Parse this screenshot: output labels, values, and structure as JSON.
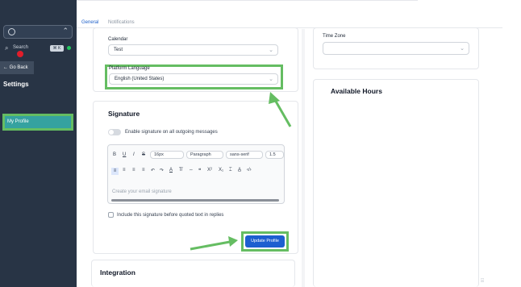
{
  "sidebar": {
    "search_placeholder": "Search",
    "search_shortcut": "⌘ K",
    "go_back_label": "← Go Back",
    "settings_title": "Settings",
    "items": [
      {
        "label": "My Profile",
        "active": true
      }
    ]
  },
  "tabs": [
    {
      "label": "General",
      "active": true
    },
    {
      "label": "Notifications",
      "active": false
    }
  ],
  "profile": {
    "calendar_label": "Calendar",
    "calendar_value": "Test",
    "platform_language_label": "Platform Language",
    "platform_language_value": "English (United States)",
    "time_zone_label": "Time Zone",
    "time_zone_value": ""
  },
  "signature": {
    "title": "Signature",
    "enable_label": "Enable signature on all outgoing messages",
    "enabled": false,
    "toolbar": {
      "bold": "B",
      "underline": "U",
      "italic": "I",
      "strike": "S",
      "font_size": "16px",
      "block_type": "Paragraph",
      "font_family": "sans-serif",
      "line_height": "1.5",
      "undo": "↶",
      "redo": "↷",
      "text_color": "A",
      "link": "⇔",
      "quote": "❝",
      "superscript": "X²",
      "subscript": "X₁",
      "clear_format": "T̸",
      "highlight": "A̲",
      "code": "‹/›"
    },
    "placeholder": "Create your email signature",
    "include_label": "Include this signature before quoted text in replies",
    "include_checked": false
  },
  "actions": {
    "update_label": "Update Profile"
  },
  "available_hours": {
    "title": "Available Hours"
  },
  "integration": {
    "title": "Integration"
  },
  "colors": {
    "sidebar_bg": "#283445",
    "accent_blue": "#1d5fd0",
    "highlight_green": "#65bd62",
    "active_item": "#35a2a0"
  }
}
